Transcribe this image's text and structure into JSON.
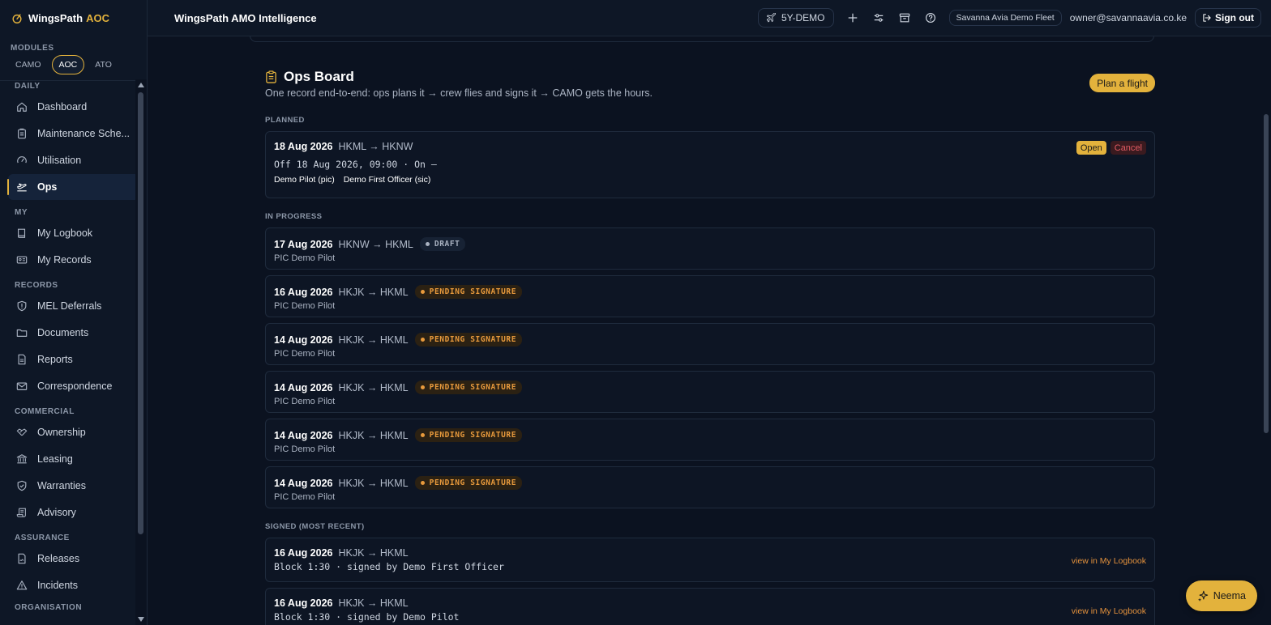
{
  "brand": {
    "name": "WingsPath",
    "module": "AOC"
  },
  "modules": {
    "label": "MODULES",
    "tabs": [
      "CAMO",
      "AOC",
      "ATO"
    ],
    "active": "AOC"
  },
  "sidebar": {
    "sections": [
      {
        "label": "DAILY",
        "items": [
          {
            "label": "Dashboard",
            "icon": "home-icon"
          },
          {
            "label": "Maintenance Sche...",
            "icon": "clipboard-icon"
          },
          {
            "label": "Utilisation",
            "icon": "gauge-icon"
          },
          {
            "label": "Ops",
            "icon": "plane-takeoff-icon",
            "active": true
          }
        ]
      },
      {
        "label": "MY",
        "items": [
          {
            "label": "My Logbook",
            "icon": "book-icon"
          },
          {
            "label": "My Records",
            "icon": "id-card-icon"
          }
        ]
      },
      {
        "label": "RECORDS",
        "items": [
          {
            "label": "MEL Deferrals",
            "icon": "shield-alert-icon"
          },
          {
            "label": "Documents",
            "icon": "folder-icon"
          },
          {
            "label": "Reports",
            "icon": "file-text-icon"
          },
          {
            "label": "Correspondence",
            "icon": "mail-icon"
          }
        ]
      },
      {
        "label": "COMMERCIAL",
        "items": [
          {
            "label": "Ownership",
            "icon": "handshake-icon"
          },
          {
            "label": "Leasing",
            "icon": "bank-icon"
          },
          {
            "label": "Warranties",
            "icon": "shield-check-icon"
          },
          {
            "label": "Advisory",
            "icon": "scroll-icon"
          }
        ]
      },
      {
        "label": "ASSURANCE",
        "items": [
          {
            "label": "Releases",
            "icon": "file-signature-icon"
          },
          {
            "label": "Incidents",
            "icon": "warning-icon"
          }
        ]
      },
      {
        "label": "ORGANISATION",
        "items": []
      }
    ]
  },
  "topbar": {
    "title": "WingsPath AMO Intelligence",
    "tail": "5Y-DEMO",
    "fleet": "Savanna Avia Demo Fleet",
    "user_email": "owner@savannaavia.co.ke",
    "signout_label": "Sign out"
  },
  "board": {
    "title": "Ops Board",
    "subtitle": "One record end-to-end: ops plans it → crew flies and signs it → CAMO gets the hours.",
    "plan_button": "Plan a flight",
    "planned_label": "PLANNED",
    "planned": [
      {
        "date": "18 Aug 2026",
        "route": "HKML → HKNW",
        "offon": "Off 18 Aug 2026, 09:00 · On —",
        "crew": [
          "Demo Pilot (pic)",
          "Demo First Officer (sic)"
        ],
        "open_label": "Open",
        "cancel_label": "Cancel"
      }
    ],
    "inprogress_label": "IN PROGRESS",
    "inprogress": [
      {
        "date": "17 Aug 2026",
        "route": "HKNW → HKML",
        "status": "DRAFT",
        "kind": "draft",
        "crew": "PIC Demo Pilot"
      },
      {
        "date": "16 Aug 2026",
        "route": "HKJK → HKML",
        "status": "PENDING SIGNATURE",
        "kind": "pending",
        "crew": "PIC Demo Pilot"
      },
      {
        "date": "14 Aug 2026",
        "route": "HKJK → HKML",
        "status": "PENDING SIGNATURE",
        "kind": "pending",
        "crew": "PIC Demo Pilot"
      },
      {
        "date": "14 Aug 2026",
        "route": "HKJK → HKML",
        "status": "PENDING SIGNATURE",
        "kind": "pending",
        "crew": "PIC Demo Pilot"
      },
      {
        "date": "14 Aug 2026",
        "route": "HKJK → HKML",
        "status": "PENDING SIGNATURE",
        "kind": "pending",
        "crew": "PIC Demo Pilot"
      },
      {
        "date": "14 Aug 2026",
        "route": "HKJK → HKML",
        "status": "PENDING SIGNATURE",
        "kind": "pending",
        "crew": "PIC Demo Pilot"
      }
    ],
    "signed_label": "SIGNED (MOST RECENT)",
    "signed": [
      {
        "date": "16 Aug 2026",
        "route": "HKJK → HKML",
        "block": "Block 1:30 · signed by Demo First Officer",
        "link": "view in My Logbook"
      },
      {
        "date": "16 Aug 2026",
        "route": "HKJK → HKML",
        "block": "Block 1:30 · signed by Demo Pilot",
        "link": "view in My Logbook"
      }
    ]
  },
  "assistant": {
    "label": "Neema"
  },
  "colors": {
    "accent": "#e3b23c",
    "pending": "#e89a3c",
    "danger": "#e25b62",
    "bg": "#0b1220"
  }
}
